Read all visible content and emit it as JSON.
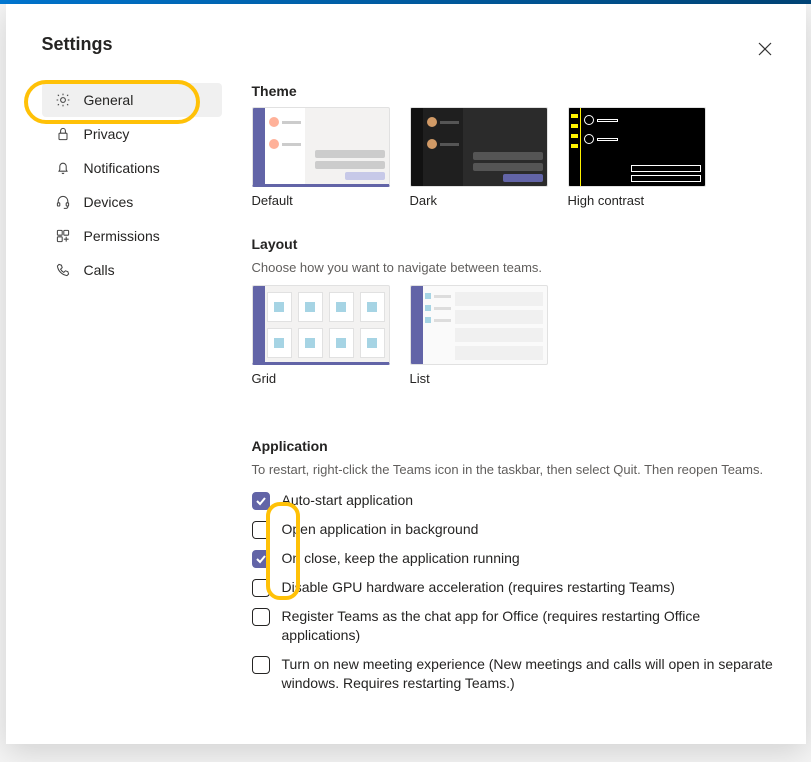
{
  "title": "Settings",
  "sidebar": {
    "items": [
      {
        "label": "General"
      },
      {
        "label": "Privacy"
      },
      {
        "label": "Notifications"
      },
      {
        "label": "Devices"
      },
      {
        "label": "Permissions"
      },
      {
        "label": "Calls"
      }
    ]
  },
  "theme": {
    "title": "Theme",
    "options": [
      {
        "label": "Default"
      },
      {
        "label": "Dark"
      },
      {
        "label": "High contrast"
      }
    ]
  },
  "layout": {
    "title": "Layout",
    "description": "Choose how you want to navigate between teams.",
    "options": [
      {
        "label": "Grid"
      },
      {
        "label": "List"
      }
    ]
  },
  "application": {
    "title": "Application",
    "description": "To restart, right-click the Teams icon in the taskbar, then select Quit. Then reopen Teams.",
    "options": [
      {
        "label": "Auto-start application",
        "checked": true
      },
      {
        "label": "Open application in background",
        "checked": false
      },
      {
        "label": "On close, keep the application running",
        "checked": true
      },
      {
        "label": "Disable GPU hardware acceleration (requires restarting Teams)",
        "checked": false
      },
      {
        "label": "Register Teams as the chat app for Office (requires restarting Office applications)",
        "checked": false
      },
      {
        "label": "Turn on new meeting experience (New meetings and calls will open in separate windows. Requires restarting Teams.)",
        "checked": false
      }
    ]
  }
}
